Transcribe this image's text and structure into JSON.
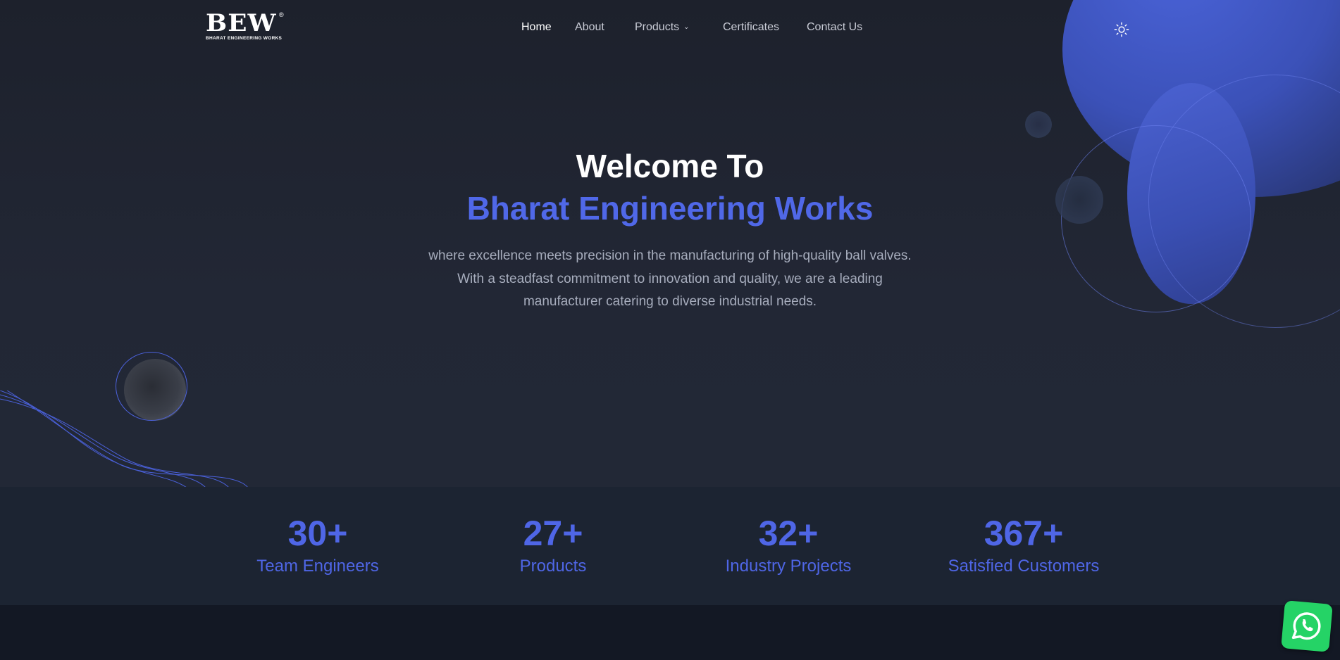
{
  "brand": {
    "logo_text": "BEW",
    "logo_reg": "®",
    "logo_sub": "BHARAT ENGINEERING WORKS"
  },
  "nav": {
    "items": [
      {
        "label": "Home",
        "active": true
      },
      {
        "label": "About",
        "active": false
      },
      {
        "label": "Products",
        "active": false,
        "dropdown": true
      },
      {
        "label": "Certificates",
        "active": false
      },
      {
        "label": "Contact Us",
        "active": false
      }
    ],
    "theme_toggle_icon": "sun-icon"
  },
  "hero": {
    "title": "Welcome To",
    "subtitle": "Bharat Engineering Works",
    "desc_line1": "where excellence meets precision in the manufacturing of high-quality ball valves.",
    "desc_line2": "With a steadfast commitment to innovation and quality, we are a leading",
    "desc_line3": "manufacturer catering to diverse industrial needs."
  },
  "stats": [
    {
      "value": "30+",
      "label": "Team Engineers"
    },
    {
      "value": "27+",
      "label": "Products"
    },
    {
      "value": "32+",
      "label": "Industry Projects"
    },
    {
      "value": "367+",
      "label": "Satisfied Customers"
    }
  ],
  "floating": {
    "whatsapp_icon": "whatsapp-icon"
  },
  "colors": {
    "accent": "#5068e8",
    "background": "#1f2330",
    "stats_background": "#1c2432",
    "whatsapp": "#25d366"
  }
}
